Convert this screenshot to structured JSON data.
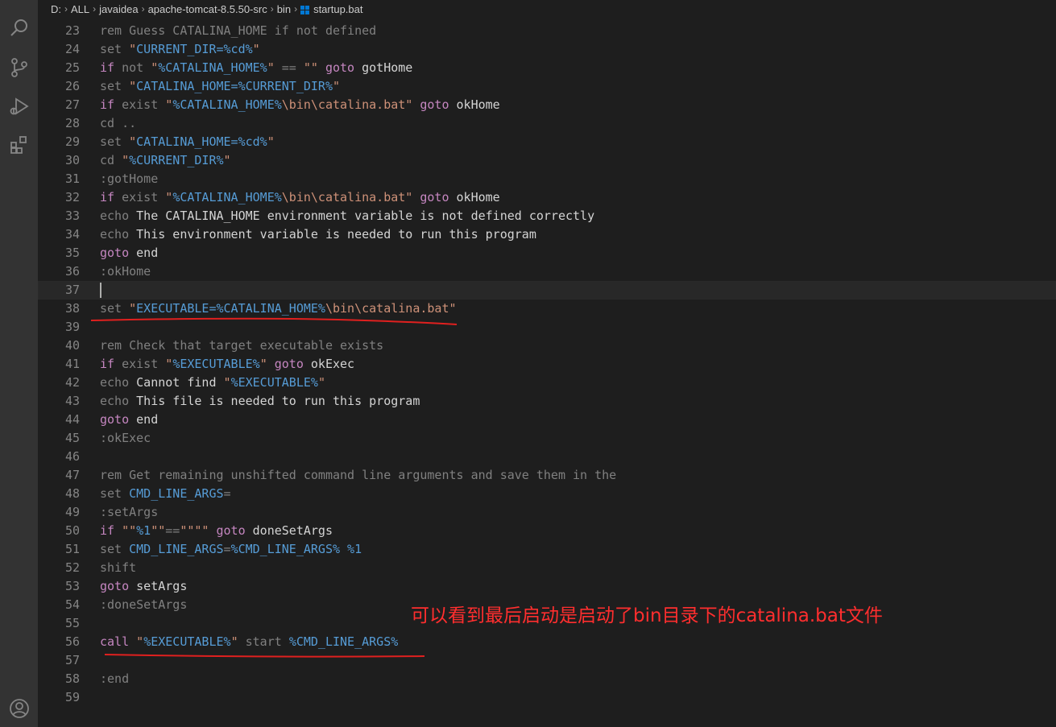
{
  "breadcrumb": [
    "D:",
    "ALL",
    "javaidea",
    "apache-tomcat-8.5.50-src",
    "bin",
    "startup.bat"
  ],
  "icons": {
    "activity": [
      "search-icon",
      "source-control-icon",
      "run-debug-icon",
      "extensions-icon",
      "account-icon"
    ],
    "file": "windows-file-icon"
  },
  "colors": {
    "keyword": "#c586c0",
    "command": "#808080",
    "string": "#ce9178",
    "variable": "#569cd6",
    "annotation": "#ff2e2e"
  },
  "editor": {
    "current_line": "37",
    "lines": [
      {
        "n": "23",
        "t": [
          [
            "rem",
            "cmd"
          ],
          [
            " Guess CATALINA_HOME if not defined",
            "cmd"
          ]
        ]
      },
      {
        "n": "24",
        "t": [
          [
            "set ",
            "cmd"
          ],
          [
            "\"",
            "str"
          ],
          [
            "CURRENT_DIR=%cd%",
            "var"
          ],
          [
            "\"",
            "str"
          ]
        ]
      },
      {
        "n": "25",
        "t": [
          [
            "if",
            "kw"
          ],
          [
            " not ",
            "cmd"
          ],
          [
            "\"",
            "str"
          ],
          [
            "%CATALINA_HOME%",
            "var"
          ],
          [
            "\"",
            "str"
          ],
          [
            " == ",
            "op"
          ],
          [
            "\"\"",
            "str"
          ],
          [
            " goto",
            "kw"
          ],
          [
            " gotHome",
            "txt"
          ]
        ]
      },
      {
        "n": "26",
        "t": [
          [
            "set ",
            "cmd"
          ],
          [
            "\"",
            "str"
          ],
          [
            "CATALINA_HOME=%CURRENT_DIR%",
            "var"
          ],
          [
            "\"",
            "str"
          ]
        ]
      },
      {
        "n": "27",
        "t": [
          [
            "if",
            "kw"
          ],
          [
            " exist ",
            "cmd"
          ],
          [
            "\"",
            "str"
          ],
          [
            "%CATALINA_HOME%",
            "var"
          ],
          [
            "\\bin\\catalina.bat\"",
            "str"
          ],
          [
            " goto",
            "kw"
          ],
          [
            " okHome",
            "txt"
          ]
        ]
      },
      {
        "n": "28",
        "t": [
          [
            "cd ..",
            "cmd"
          ]
        ]
      },
      {
        "n": "29",
        "t": [
          [
            "set ",
            "cmd"
          ],
          [
            "\"",
            "str"
          ],
          [
            "CATALINA_HOME=%cd%",
            "var"
          ],
          [
            "\"",
            "str"
          ]
        ]
      },
      {
        "n": "30",
        "t": [
          [
            "cd ",
            "cmd"
          ],
          [
            "\"",
            "str"
          ],
          [
            "%CURRENT_DIR%",
            "var"
          ],
          [
            "\"",
            "str"
          ]
        ]
      },
      {
        "n": "31",
        "t": [
          [
            ":gotHome",
            "lbl"
          ]
        ]
      },
      {
        "n": "32",
        "t": [
          [
            "if",
            "kw"
          ],
          [
            " exist ",
            "cmd"
          ],
          [
            "\"",
            "str"
          ],
          [
            "%CATALINA_HOME%",
            "var"
          ],
          [
            "\\bin\\catalina.bat\"",
            "str"
          ],
          [
            " goto",
            "kw"
          ],
          [
            " okHome",
            "txt"
          ]
        ]
      },
      {
        "n": "33",
        "t": [
          [
            "echo",
            "cmd"
          ],
          [
            " The CATALINA_HOME environment variable is not defined correctly",
            "txt"
          ]
        ]
      },
      {
        "n": "34",
        "t": [
          [
            "echo",
            "cmd"
          ],
          [
            " This environment variable is needed to run this program",
            "txt"
          ]
        ]
      },
      {
        "n": "35",
        "t": [
          [
            "goto",
            "kw"
          ],
          [
            " end",
            "txt"
          ]
        ]
      },
      {
        "n": "36",
        "t": [
          [
            ":okHome",
            "lbl"
          ]
        ]
      },
      {
        "n": "37",
        "t": []
      },
      {
        "n": "38",
        "t": [
          [
            "set ",
            "cmd"
          ],
          [
            "\"",
            "str"
          ],
          [
            "EXECUTABLE=%CATALINA_HOME%",
            "var"
          ],
          [
            "\\bin\\catalina.bat\"",
            "str"
          ]
        ]
      },
      {
        "n": "39",
        "t": []
      },
      {
        "n": "40",
        "t": [
          [
            "rem",
            "cmd"
          ],
          [
            " Check that target executable exists",
            "cmd"
          ]
        ]
      },
      {
        "n": "41",
        "t": [
          [
            "if",
            "kw"
          ],
          [
            " exist ",
            "cmd"
          ],
          [
            "\"",
            "str"
          ],
          [
            "%EXECUTABLE%",
            "var"
          ],
          [
            "\"",
            "str"
          ],
          [
            " goto",
            "kw"
          ],
          [
            " okExec",
            "txt"
          ]
        ]
      },
      {
        "n": "42",
        "t": [
          [
            "echo",
            "cmd"
          ],
          [
            " Cannot find ",
            "txt"
          ],
          [
            "\"",
            "str"
          ],
          [
            "%EXECUTABLE%",
            "var"
          ],
          [
            "\"",
            "str"
          ]
        ]
      },
      {
        "n": "43",
        "t": [
          [
            "echo",
            "cmd"
          ],
          [
            " This file is needed to run this program",
            "txt"
          ]
        ]
      },
      {
        "n": "44",
        "t": [
          [
            "goto",
            "kw"
          ],
          [
            " end",
            "txt"
          ]
        ]
      },
      {
        "n": "45",
        "t": [
          [
            ":okExec",
            "lbl"
          ]
        ]
      },
      {
        "n": "46",
        "t": []
      },
      {
        "n": "47",
        "t": [
          [
            "rem",
            "cmd"
          ],
          [
            " Get remaining unshifted command line arguments and save them in the",
            "cmd"
          ]
        ]
      },
      {
        "n": "48",
        "t": [
          [
            "set ",
            "cmd"
          ],
          [
            "CMD_LINE_ARGS",
            "var"
          ],
          [
            "=",
            "op"
          ]
        ]
      },
      {
        "n": "49",
        "t": [
          [
            ":setArgs",
            "lbl"
          ]
        ]
      },
      {
        "n": "50",
        "t": [
          [
            "if",
            "kw"
          ],
          [
            " \"\"",
            "str"
          ],
          [
            "%1",
            "var"
          ],
          [
            "\"\"",
            "str"
          ],
          [
            "==",
            "op"
          ],
          [
            "\"\"\"\"",
            "str"
          ],
          [
            " goto",
            "kw"
          ],
          [
            " doneSetArgs",
            "txt"
          ]
        ]
      },
      {
        "n": "51",
        "t": [
          [
            "set ",
            "cmd"
          ],
          [
            "CMD_LINE_ARGS",
            "var"
          ],
          [
            "=",
            "op"
          ],
          [
            "%CMD_LINE_ARGS%",
            "var"
          ],
          [
            " %1",
            "var"
          ]
        ]
      },
      {
        "n": "52",
        "t": [
          [
            "shift",
            "cmd"
          ]
        ]
      },
      {
        "n": "53",
        "t": [
          [
            "goto",
            "kw"
          ],
          [
            " setArgs",
            "txt"
          ]
        ]
      },
      {
        "n": "54",
        "t": [
          [
            ":doneSetArgs",
            "lbl"
          ]
        ]
      },
      {
        "n": "55",
        "t": []
      },
      {
        "n": "56",
        "t": [
          [
            "call",
            "kw"
          ],
          [
            " \"",
            "str"
          ],
          [
            "%EXECUTABLE%",
            "var"
          ],
          [
            "\"",
            "str"
          ],
          [
            " start ",
            "cmd"
          ],
          [
            "%CMD_LINE_ARGS%",
            "var"
          ]
        ]
      },
      {
        "n": "57",
        "t": []
      },
      {
        "n": "58",
        "t": [
          [
            ":end",
            "lbl"
          ]
        ]
      },
      {
        "n": "59",
        "t": []
      }
    ]
  },
  "annotation": {
    "text": "可以看到最后启动是启动了bin目录下的catalina.bat文件"
  }
}
